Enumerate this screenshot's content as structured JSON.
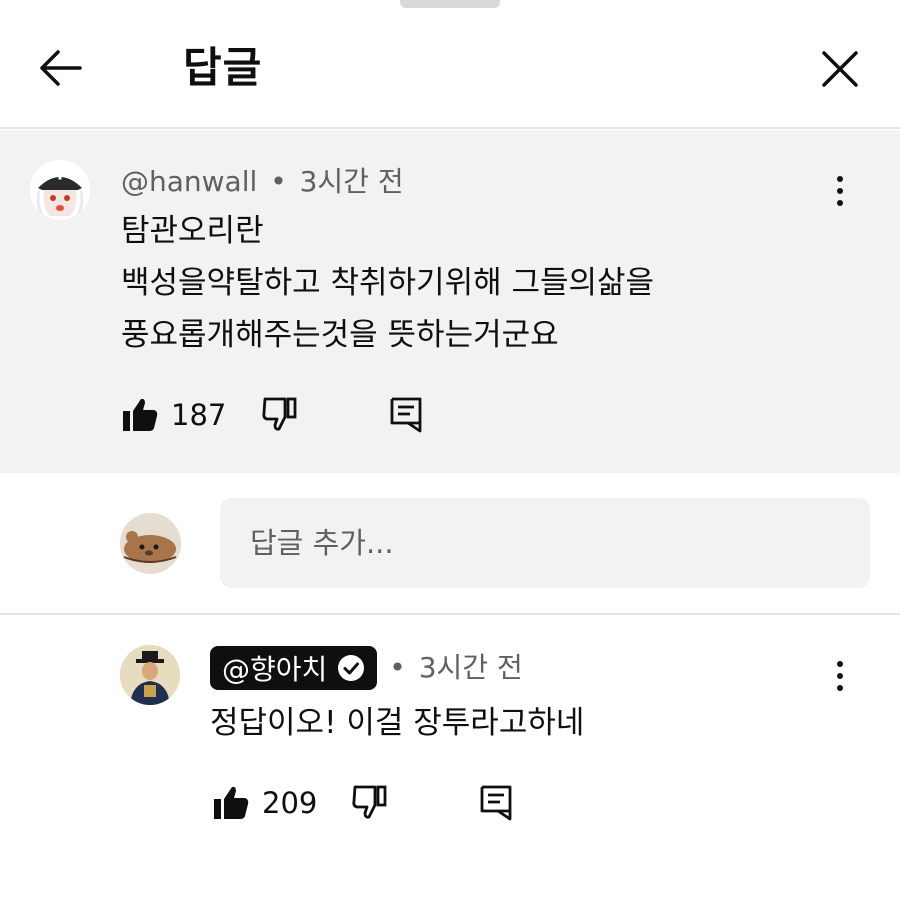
{
  "header": {
    "title": "답글"
  },
  "parent_comment": {
    "author": "@hanwall",
    "separator": "•",
    "time": "3시간 전",
    "lines": [
      "탐관오리란",
      "백성을약탈하고 착취하기위해 그들의삶을",
      "풍요롭개해주는것을 뜻하는거군요"
    ],
    "like_count": "187"
  },
  "reply_box": {
    "placeholder": "답글 추가..."
  },
  "reply": {
    "author": "@향아치",
    "separator": "•",
    "time": "3시간 전",
    "text": "정답이오! 이걸 장투라고하네",
    "like_count": "209"
  },
  "icons": {
    "back": "arrow-left-icon",
    "close": "close-icon",
    "like": "thumbs-up-icon",
    "dislike": "thumbs-down-icon",
    "reply": "comment-reply-icon",
    "more": "more-vertical-icon",
    "verified": "verified-check-icon"
  }
}
